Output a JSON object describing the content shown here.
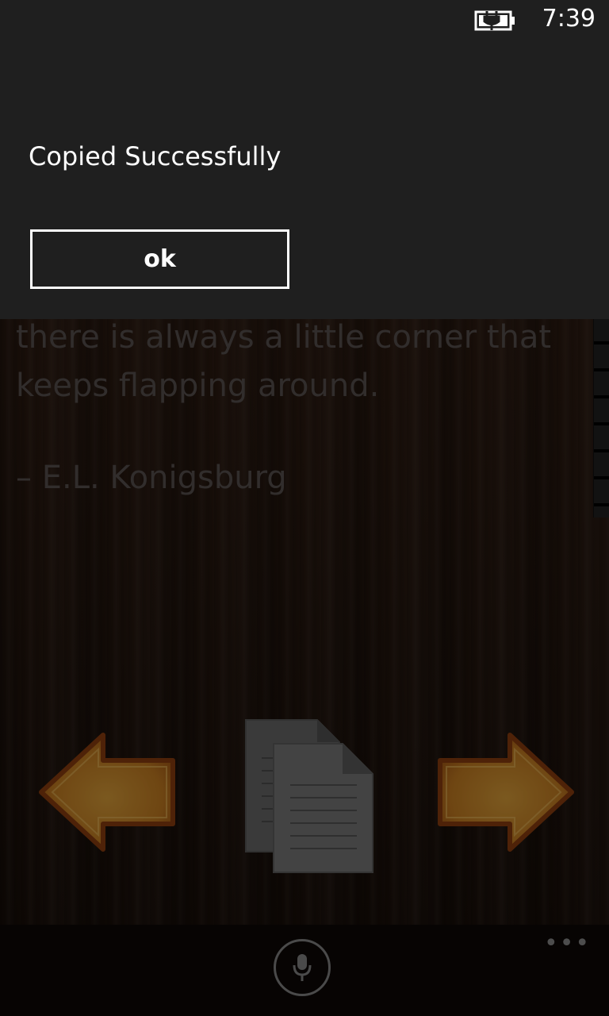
{
  "status_bar": {
    "time": "7:39",
    "battery_icon": "battery-charging-icon"
  },
  "dialog": {
    "message": "Copied Successfully",
    "ok_label": "ok"
  },
  "quote": {
    "lines": [
      "there is always a little corner that",
      "keeps flapping around."
    ],
    "author": "– E.L. Konigsburg"
  },
  "controls": {
    "prev_icon": "arrow-left-icon",
    "copy_icon": "copy-documents-icon",
    "next_icon": "arrow-right-icon"
  },
  "app_bar": {
    "mic_icon": "microphone-icon",
    "more_label": "•••"
  },
  "colors": {
    "arrow_fill": "#d4922a",
    "arrow_border": "#9b4a12",
    "dialog_bg": "#1f1f1f"
  }
}
